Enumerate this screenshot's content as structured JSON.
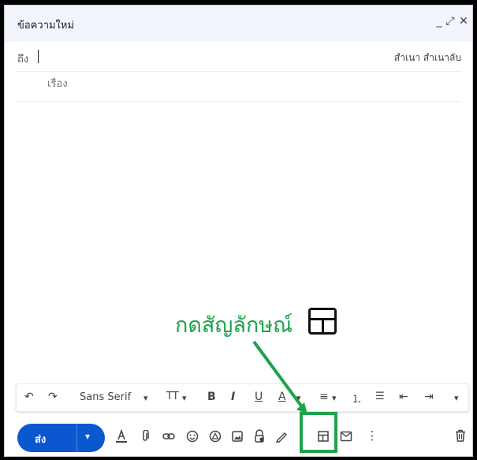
{
  "compose": {
    "title": "ข้อความใหม่",
    "controls": {
      "minimize": "_",
      "expand": "⤢",
      "close": "✕"
    },
    "to_label": "ถึง",
    "cc_bcc": "สำเนา สำเนาลับ",
    "subject_placeholder": "เรื่อง"
  },
  "annotation": {
    "text": "กดสัญลักษณ์",
    "color": "#1ea24a"
  },
  "formatting": {
    "undo": "↶",
    "redo": "↷",
    "font": "Sans Serif",
    "font_dropdown": "▾",
    "size": "TT",
    "size_dropdown": "▾",
    "bold": "B",
    "italic": "I",
    "underline": "U",
    "text_color": "A",
    "text_color_dropdown": "▾",
    "align": "≡",
    "align_dropdown": "▾",
    "numbered_list": "⒈",
    "bulleted_list": "☰",
    "indent_less": "⇤",
    "indent_more": "⇥",
    "more": "▾"
  },
  "bottom_toolbar": {
    "send_label": "ส่ง",
    "send_dropdown": "▾",
    "more_options": "⋮"
  },
  "colors": {
    "send": "#0b57d0",
    "header": "#f2f6fc",
    "highlight": "#1ea24a"
  }
}
